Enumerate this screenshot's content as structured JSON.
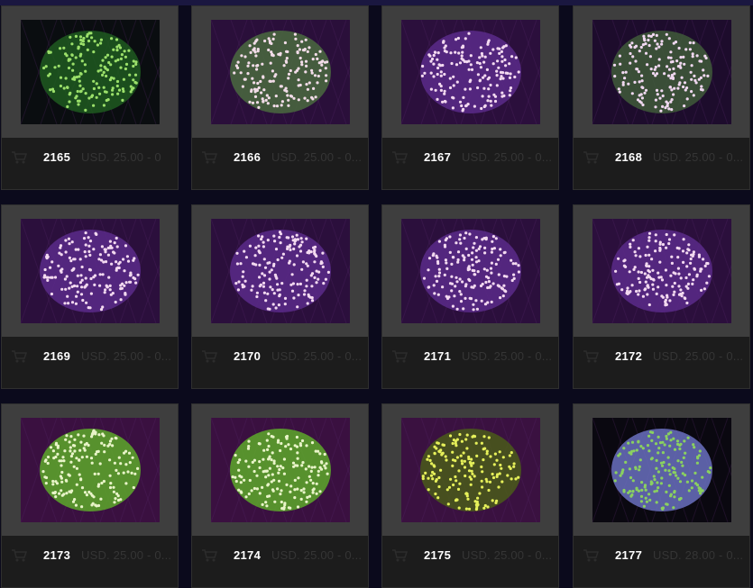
{
  "products": [
    {
      "sku": "2165",
      "price": "USD. 25.00 - 0",
      "palette": "green"
    },
    {
      "sku": "2166",
      "price": "USD. 25.00 - 0...",
      "palette": "green-pink"
    },
    {
      "sku": "2167",
      "price": "USD. 25.00 - 0...",
      "palette": "purple"
    },
    {
      "sku": "2168",
      "price": "USD. 25.00 - 0...",
      "palette": "purple-green"
    },
    {
      "sku": "2169",
      "price": "USD. 25.00 - 0...",
      "palette": "purple"
    },
    {
      "sku": "2170",
      "price": "USD. 25.00 - 0...",
      "palette": "purple"
    },
    {
      "sku": "2171",
      "price": "USD. 25.00 - 0...",
      "palette": "purple"
    },
    {
      "sku": "2172",
      "price": "USD. 25.00 - 0...",
      "palette": "purple"
    },
    {
      "sku": "2173",
      "price": "USD. 25.00 - 0...",
      "palette": "bright-green"
    },
    {
      "sku": "2174",
      "price": "USD. 25.00 - 0...",
      "palette": "bright-green"
    },
    {
      "sku": "2175",
      "price": "USD. 25.00 - 0...",
      "palette": "yellow-purple"
    },
    {
      "sku": "2177",
      "price": "USD. 28.00 - 0...",
      "palette": "blue-green"
    }
  ],
  "palettes": {
    "green": {
      "bg": "#0a0d10",
      "body": "#1f5a20",
      "tip": "#9be06a"
    },
    "green-pink": {
      "bg": "#2a0f3a",
      "body": "#4a6a40",
      "tip": "#f2dce8"
    },
    "purple": {
      "bg": "#2b0f3c",
      "body": "#5a2a8a",
      "tip": "#f3d9f0"
    },
    "purple-green": {
      "bg": "#1d0c2c",
      "body": "#3f5a3a",
      "tip": "#f0d8f0"
    },
    "bright-green": {
      "bg": "#3a1040",
      "body": "#5da82a",
      "tip": "#e8f4c8"
    },
    "yellow-purple": {
      "bg": "#3a1140",
      "body": "#4a5a1a",
      "tip": "#e6f05a"
    },
    "blue-green": {
      "bg": "#0a0810",
      "body": "#6a70c0",
      "tip": "#8ad060"
    }
  }
}
